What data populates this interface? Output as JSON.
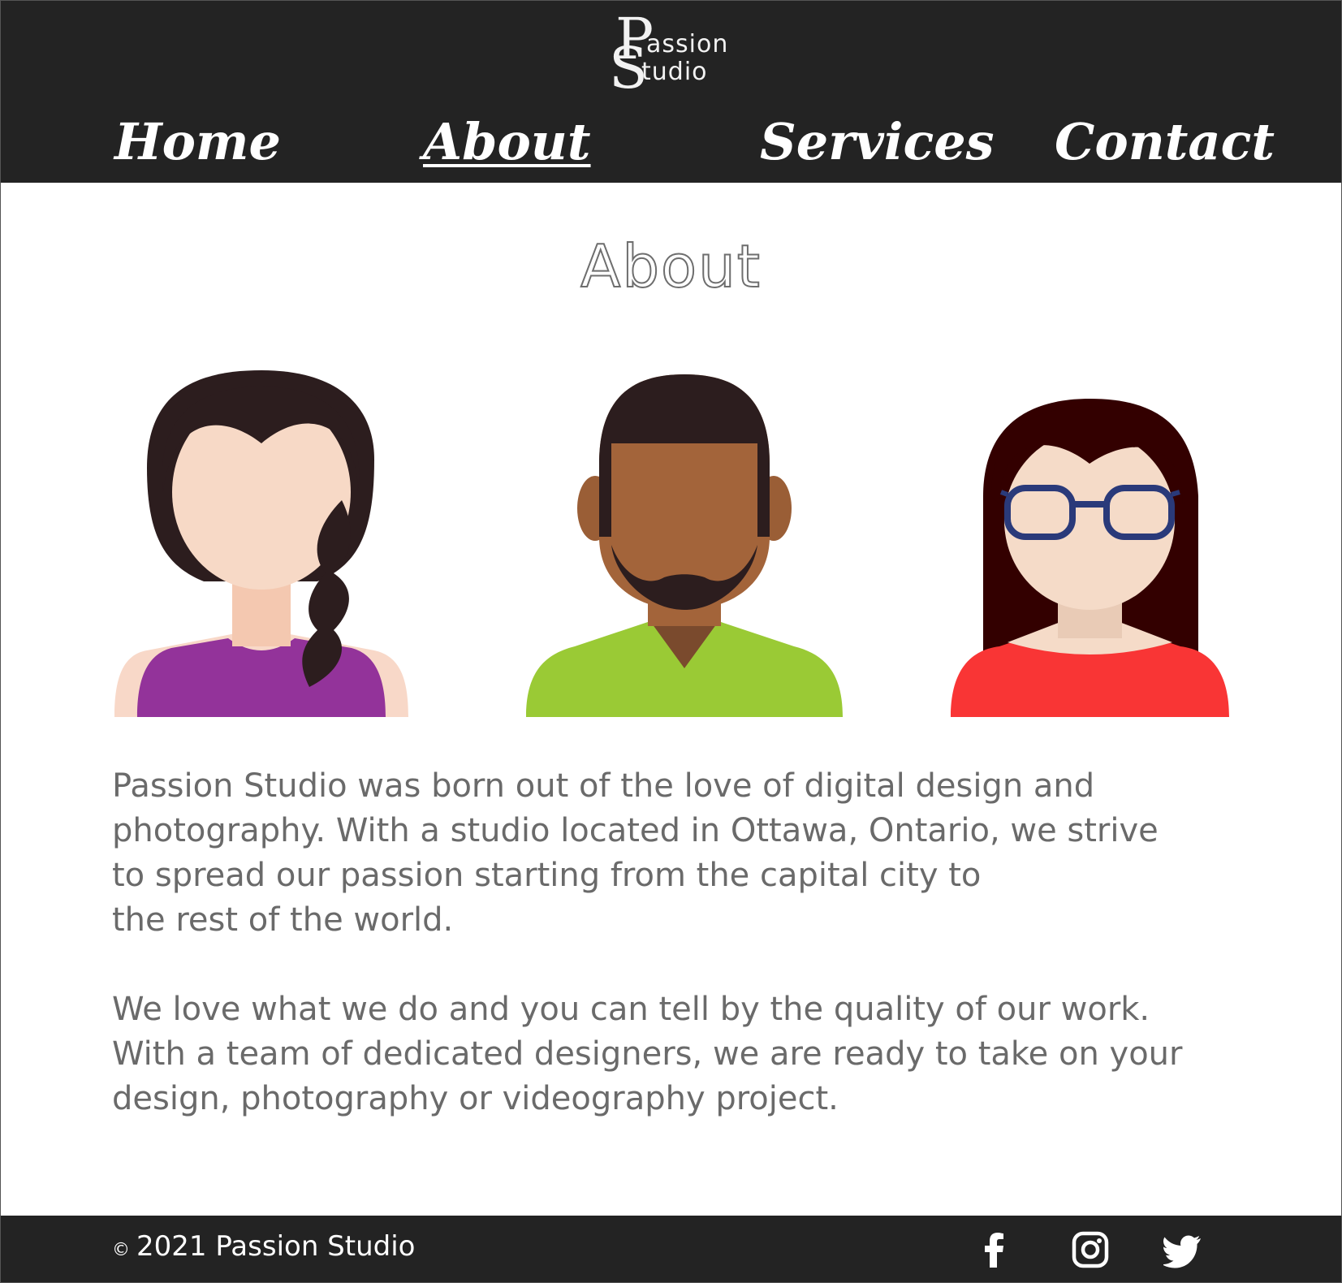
{
  "brand": {
    "logo_letter_p": "P",
    "logo_letter_s": "S",
    "logo_rest_1": "assion",
    "logo_rest_2": "tudio"
  },
  "nav": {
    "items": [
      {
        "label": "Home",
        "active": false
      },
      {
        "label": "About",
        "active": true
      },
      {
        "label": "Services",
        "active": false
      },
      {
        "label": "Contact",
        "active": false
      }
    ]
  },
  "main": {
    "title": "About",
    "paragraphs": [
      "Passion Studio was born out of the love of digital design and\nphotography. With a studio located in Ottawa, Ontario, we strive\nto spread our passion starting from the capital city to\nthe rest of the world.",
      "We love what we do and you can tell by the quality of our work.\nWith a team of dedicated designers, we are ready to take on your\ndesign, photography or videography project."
    ],
    "avatars": [
      "woman-braid-avatar",
      "man-beard-avatar",
      "woman-glasses-avatar"
    ]
  },
  "footer": {
    "copyright_symbol": "©",
    "copyright_text": "2021 Passion Studio",
    "social_icons": [
      "facebook-icon",
      "instagram-icon",
      "twitter-icon"
    ]
  },
  "colors": {
    "header_bg": "#232323",
    "text_gray": "#6a6a6a",
    "shirt_purple": "#93339a",
    "shirt_green": "#9aca35",
    "shirt_red": "#f93535",
    "glasses_blue": "#2a3a7a"
  }
}
